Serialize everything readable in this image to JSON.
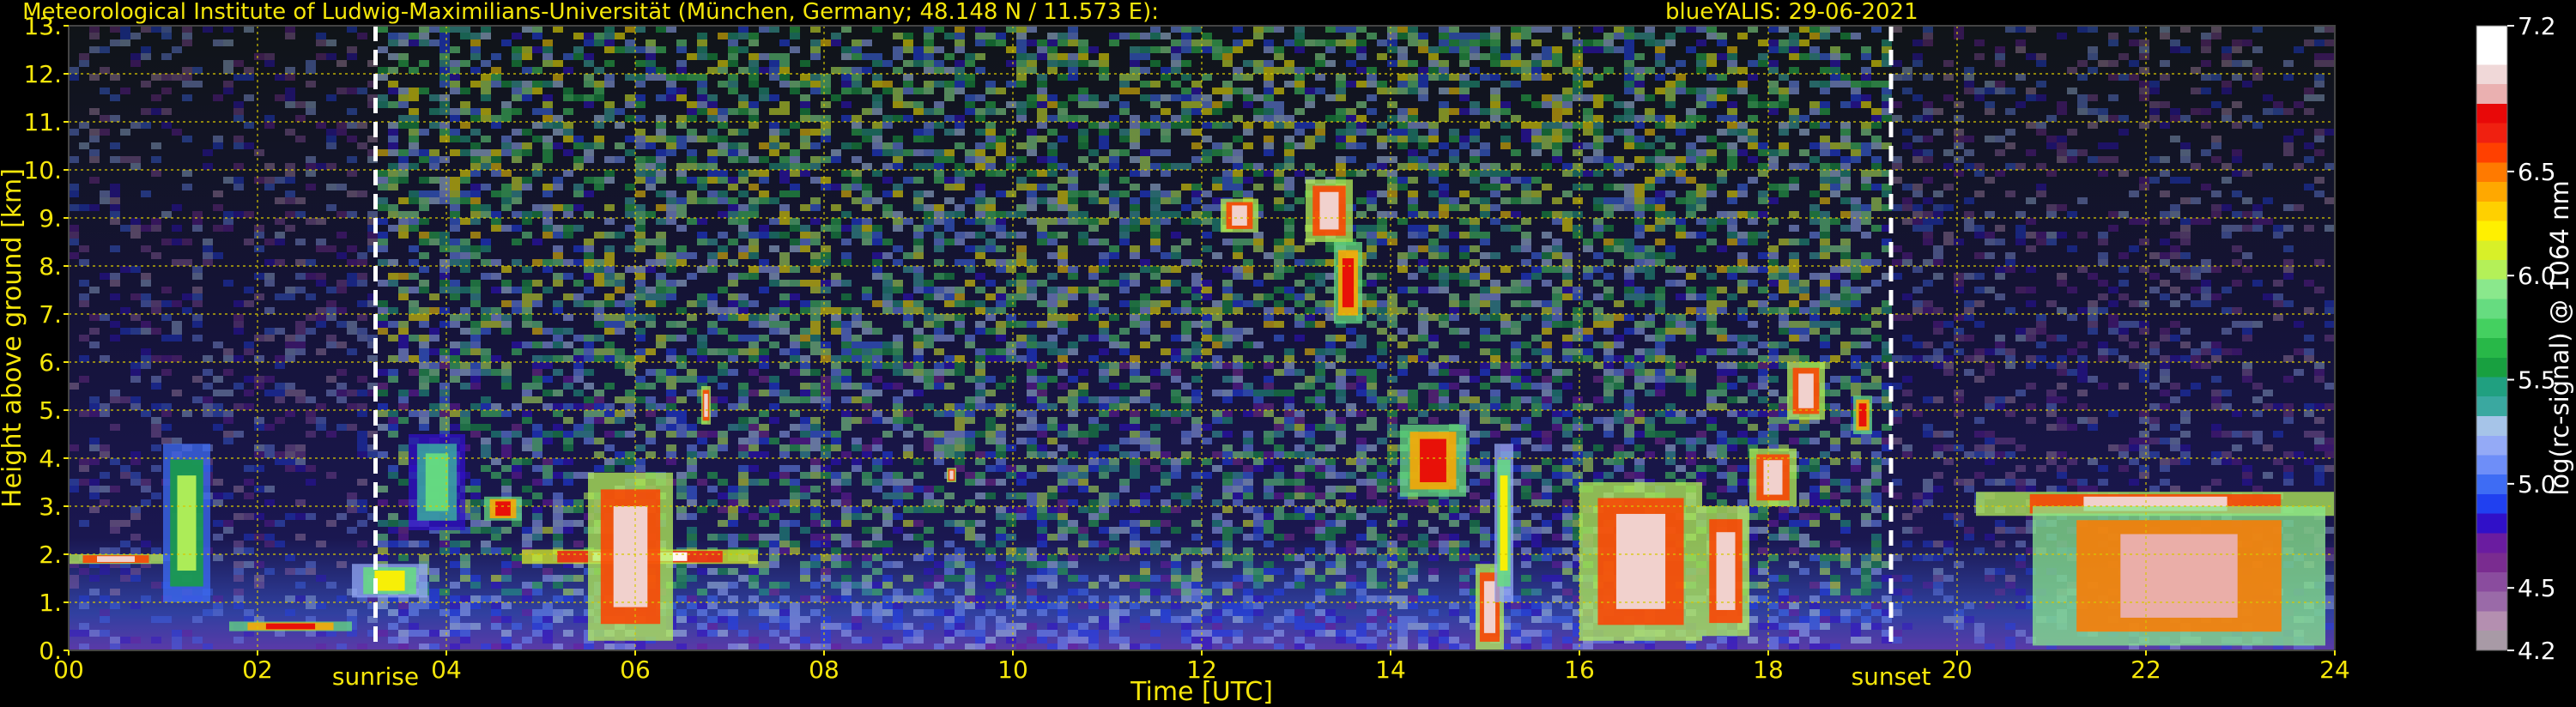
{
  "chart_data": {
    "type": "heatmap",
    "title_left": "Meteorological Institute of Ludwig-Maximilians-Universität (München, Germany; 48.148 N / 11.573 E):",
    "title_right": "blueYALIS: 29-06-2021",
    "xlabel": "Time [UTC]",
    "ylabel": "Height above ground [km]",
    "xlim": [
      0,
      24
    ],
    "ylim": [
      0,
      13
    ],
    "x_ticks": [
      {
        "value": 0,
        "label": "00"
      },
      {
        "value": 2,
        "label": "02"
      },
      {
        "value": 4,
        "label": "04"
      },
      {
        "value": 6,
        "label": "06"
      },
      {
        "value": 8,
        "label": "08"
      },
      {
        "value": 10,
        "label": "10"
      },
      {
        "value": 12,
        "label": "12"
      },
      {
        "value": 14,
        "label": "14"
      },
      {
        "value": 16,
        "label": "16"
      },
      {
        "value": 18,
        "label": "18"
      },
      {
        "value": 20,
        "label": "20"
      },
      {
        "value": 22,
        "label": "22"
      },
      {
        "value": 24,
        "label": "24"
      }
    ],
    "y_ticks": [
      {
        "value": 0,
        "label": "0."
      },
      {
        "value": 1,
        "label": "1."
      },
      {
        "value": 2,
        "label": "2."
      },
      {
        "value": 3,
        "label": "3."
      },
      {
        "value": 4,
        "label": "4."
      },
      {
        "value": 5,
        "label": "5."
      },
      {
        "value": 6,
        "label": "6."
      },
      {
        "value": 7,
        "label": "7."
      },
      {
        "value": 8,
        "label": "8."
      },
      {
        "value": 9,
        "label": "9."
      },
      {
        "value": 10,
        "label": "10."
      },
      {
        "value": 11,
        "label": "11."
      },
      {
        "value": 12,
        "label": "12."
      },
      {
        "value": 13,
        "label": "13."
      }
    ],
    "grid": true,
    "grid_color": "#d8c800",
    "annotations": [
      {
        "label": "sunrise",
        "x": 3.25
      },
      {
        "label": "sunset",
        "x": 19.3
      }
    ],
    "colorbar": {
      "label": "log(rc-signal) @ 1064 nm",
      "range": [
        4.2,
        7.2
      ],
      "ticks": [
        {
          "value": 4.2,
          "label": "4.2"
        },
        {
          "value": 4.5,
          "label": "4.5"
        },
        {
          "value": 5.0,
          "label": "5.0"
        },
        {
          "value": 5.5,
          "label": "5.5"
        },
        {
          "value": 6.0,
          "label": "6.0"
        },
        {
          "value": 6.5,
          "label": "6.5"
        },
        {
          "value": 7.2,
          "label": "7.2"
        }
      ],
      "colors": [
        "#a89aa6",
        "#b48fb0",
        "#9a6aa8",
        "#8a4c9e",
        "#7a2c90",
        "#6a1ca0",
        "#3010c8",
        "#2040f0",
        "#3e6cf4",
        "#6e8ef8",
        "#94aaf6",
        "#a6c4e8",
        "#3aa8a0",
        "#20a080",
        "#18a040",
        "#28b848",
        "#44d060",
        "#66dc80",
        "#8ae88c",
        "#b4f058",
        "#d8f028",
        "#fff000",
        "#ffd000",
        "#ffa800",
        "#ff7a00",
        "#ff4000",
        "#f02010",
        "#e80808",
        "#eab0b0",
        "#f0d8d8",
        "#ffffff",
        "#ffffff"
      ]
    },
    "features": [
      {
        "type": "cloud_layer",
        "x": [
          0.0,
          1.0
        ],
        "y": [
          1.8,
          2.0
        ],
        "value": 7.0
      },
      {
        "type": "cloud",
        "x": [
          1.0,
          1.5
        ],
        "y": [
          1.0,
          4.3
        ],
        "value": 6.0
      },
      {
        "type": "cloud_layer",
        "x": [
          1.7,
          3.0
        ],
        "y": [
          0.4,
          0.6
        ],
        "value": 6.8
      },
      {
        "type": "cloud_layer",
        "x": [
          3.0,
          3.8
        ],
        "y": [
          1.1,
          1.8
        ],
        "value": 6.2
      },
      {
        "type": "cloud",
        "x": [
          3.6,
          4.2
        ],
        "y": [
          2.5,
          4.5
        ],
        "value": 5.8
      },
      {
        "type": "cloud_layer",
        "x": [
          4.4,
          4.8
        ],
        "y": [
          2.7,
          3.2
        ],
        "value": 6.8
      },
      {
        "type": "cloud_layer",
        "x": [
          4.8,
          7.3
        ],
        "y": [
          1.8,
          2.1
        ],
        "value": 7.1
      },
      {
        "type": "cloud",
        "x": [
          5.5,
          6.4
        ],
        "y": [
          0.2,
          3.7
        ],
        "value": 7.0
      },
      {
        "type": "cloud",
        "x": [
          6.7,
          6.8
        ],
        "y": [
          4.7,
          5.5
        ],
        "value": 7.0
      },
      {
        "type": "cloud",
        "x": [
          9.3,
          9.4
        ],
        "y": [
          3.5,
          3.8
        ],
        "value": 7.0
      },
      {
        "type": "cirrus",
        "x": [
          12.2,
          12.6
        ],
        "y": [
          8.7,
          9.4
        ],
        "value": 7.0
      },
      {
        "type": "cirrus",
        "x": [
          13.1,
          13.6
        ],
        "y": [
          8.5,
          9.8
        ],
        "value": 7.0
      },
      {
        "type": "cirrus",
        "x": [
          13.4,
          13.7
        ],
        "y": [
          6.8,
          8.5
        ],
        "value": 6.8
      },
      {
        "type": "cloud",
        "x": [
          14.1,
          14.8
        ],
        "y": [
          3.2,
          4.7
        ],
        "value": 6.8
      },
      {
        "type": "cloud",
        "x": [
          14.9,
          15.2
        ],
        "y": [
          0.0,
          1.8
        ],
        "value": 7.0
      },
      {
        "type": "cloud",
        "x": [
          15.1,
          15.3
        ],
        "y": [
          1.0,
          4.3
        ],
        "value": 6.2
      },
      {
        "type": "cloud",
        "x": [
          16.0,
          17.3
        ],
        "y": [
          0.2,
          3.5
        ],
        "value": 7.0
      },
      {
        "type": "cloud",
        "x": [
          17.3,
          17.8
        ],
        "y": [
          0.3,
          3.0
        ],
        "value": 7.0
      },
      {
        "type": "cloud",
        "x": [
          17.8,
          18.3
        ],
        "y": [
          3.0,
          4.2
        ],
        "value": 7.0
      },
      {
        "type": "cloud",
        "x": [
          18.2,
          18.6
        ],
        "y": [
          4.8,
          6.0
        ],
        "value": 7.0
      },
      {
        "type": "cloud",
        "x": [
          18.9,
          19.1
        ],
        "y": [
          4.5,
          5.3
        ],
        "value": 6.8
      },
      {
        "type": "cloud_layer",
        "x": [
          20.2,
          24.0
        ],
        "y": [
          2.8,
          3.3
        ],
        "value": 7.0
      },
      {
        "type": "cloud",
        "x": [
          20.8,
          23.9
        ],
        "y": [
          0.1,
          3.0
        ],
        "value": 6.9
      }
    ]
  }
}
